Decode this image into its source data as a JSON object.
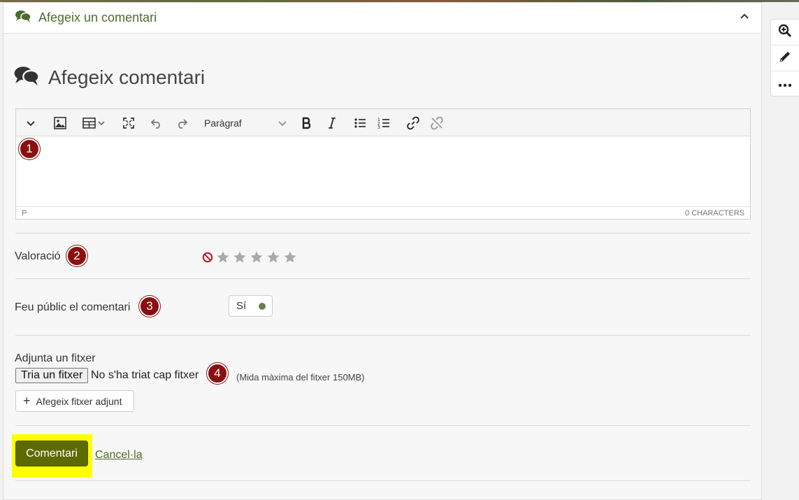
{
  "card": {
    "header_title": "Afegeix un comentari"
  },
  "form": {
    "heading": "Afegeix comentari",
    "editor": {
      "paragraph_format": "Paràgraf",
      "status_path": "P",
      "char_count": "0 CHARACTERS"
    },
    "rating": {
      "label": "Valoració",
      "max_stars": 5,
      "value": 0
    },
    "public": {
      "label": "Feu públic el comentari",
      "value": "Sí"
    },
    "attachment": {
      "label": "Adjunta un fitxer",
      "choose_button": "Tria un fitxer",
      "no_file": "No s'ha triat cap fitxer",
      "max_size": "(Mida màxima del fitxer 150MB)",
      "add_button": "Afegeix fitxer adjunt"
    },
    "actions": {
      "submit": "Comentari",
      "cancel": "Cancel·la"
    }
  },
  "badges": [
    "1",
    "2",
    "3",
    "4"
  ],
  "colors": {
    "accent_green": "#4f6b2a",
    "submit_bg": "#5c6b00",
    "badge_red": "#8b0f0f",
    "highlight_yellow": "#ffff00",
    "star_gray": "#a9a9a9",
    "no_rating_red": "#c0172b"
  }
}
